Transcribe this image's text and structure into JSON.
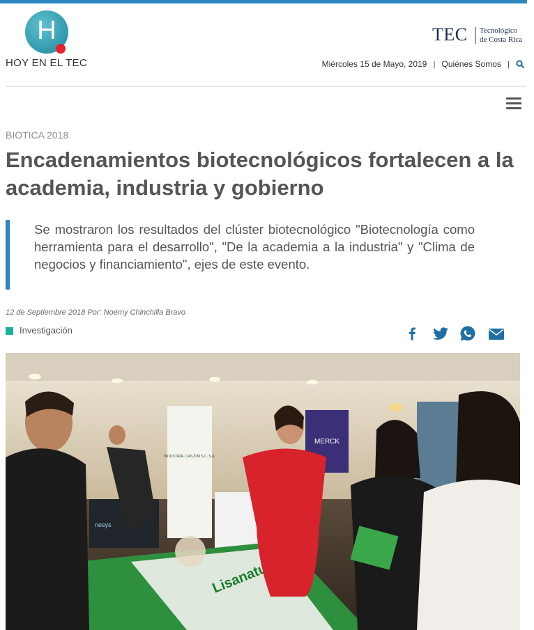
{
  "site": {
    "logo_letter": "H",
    "logo_text": "HOY EN EL TEC",
    "brand_colors": {
      "accent": "#2b87c0",
      "logo_teal": "#2f98ab",
      "logo_red": "#e5212b",
      "tag_green": "#19b39b"
    }
  },
  "institution": {
    "abbr": "TEC",
    "name_line1": "Tecnológico",
    "name_line2": "de Costa Rica"
  },
  "header": {
    "date": "Miércoles 15 de Mayo, 2019",
    "about_link": "Quiénes Somos",
    "search_icon": "search-icon",
    "menu_icon": "hamburger-menu-icon"
  },
  "article": {
    "category": "BIOTICA 2018",
    "title": "Encadenamientos biotecnológicos fortalecen a la academia, industria y gobierno",
    "lead": "Se mostraron los  resultados del clúster biotecnológico \"Biotecnología como herramienta para el desarrollo\", \"De la academia a la industria\" y \"Clima de negocios y financiamiento\", ejes de este evento.",
    "byline": "12 de Septiembre 2018 Por: Noemy Chinchilla Bravo",
    "tag": "Investigación",
    "share_icons": [
      "facebook-icon",
      "twitter-icon",
      "whatsapp-icon",
      "email-icon"
    ],
    "photo_banner_texts": [
      "INDUSTRIAL CASJOM S.C. S.A.",
      "MERCK",
      "Lisanatura",
      "nesys"
    ]
  }
}
